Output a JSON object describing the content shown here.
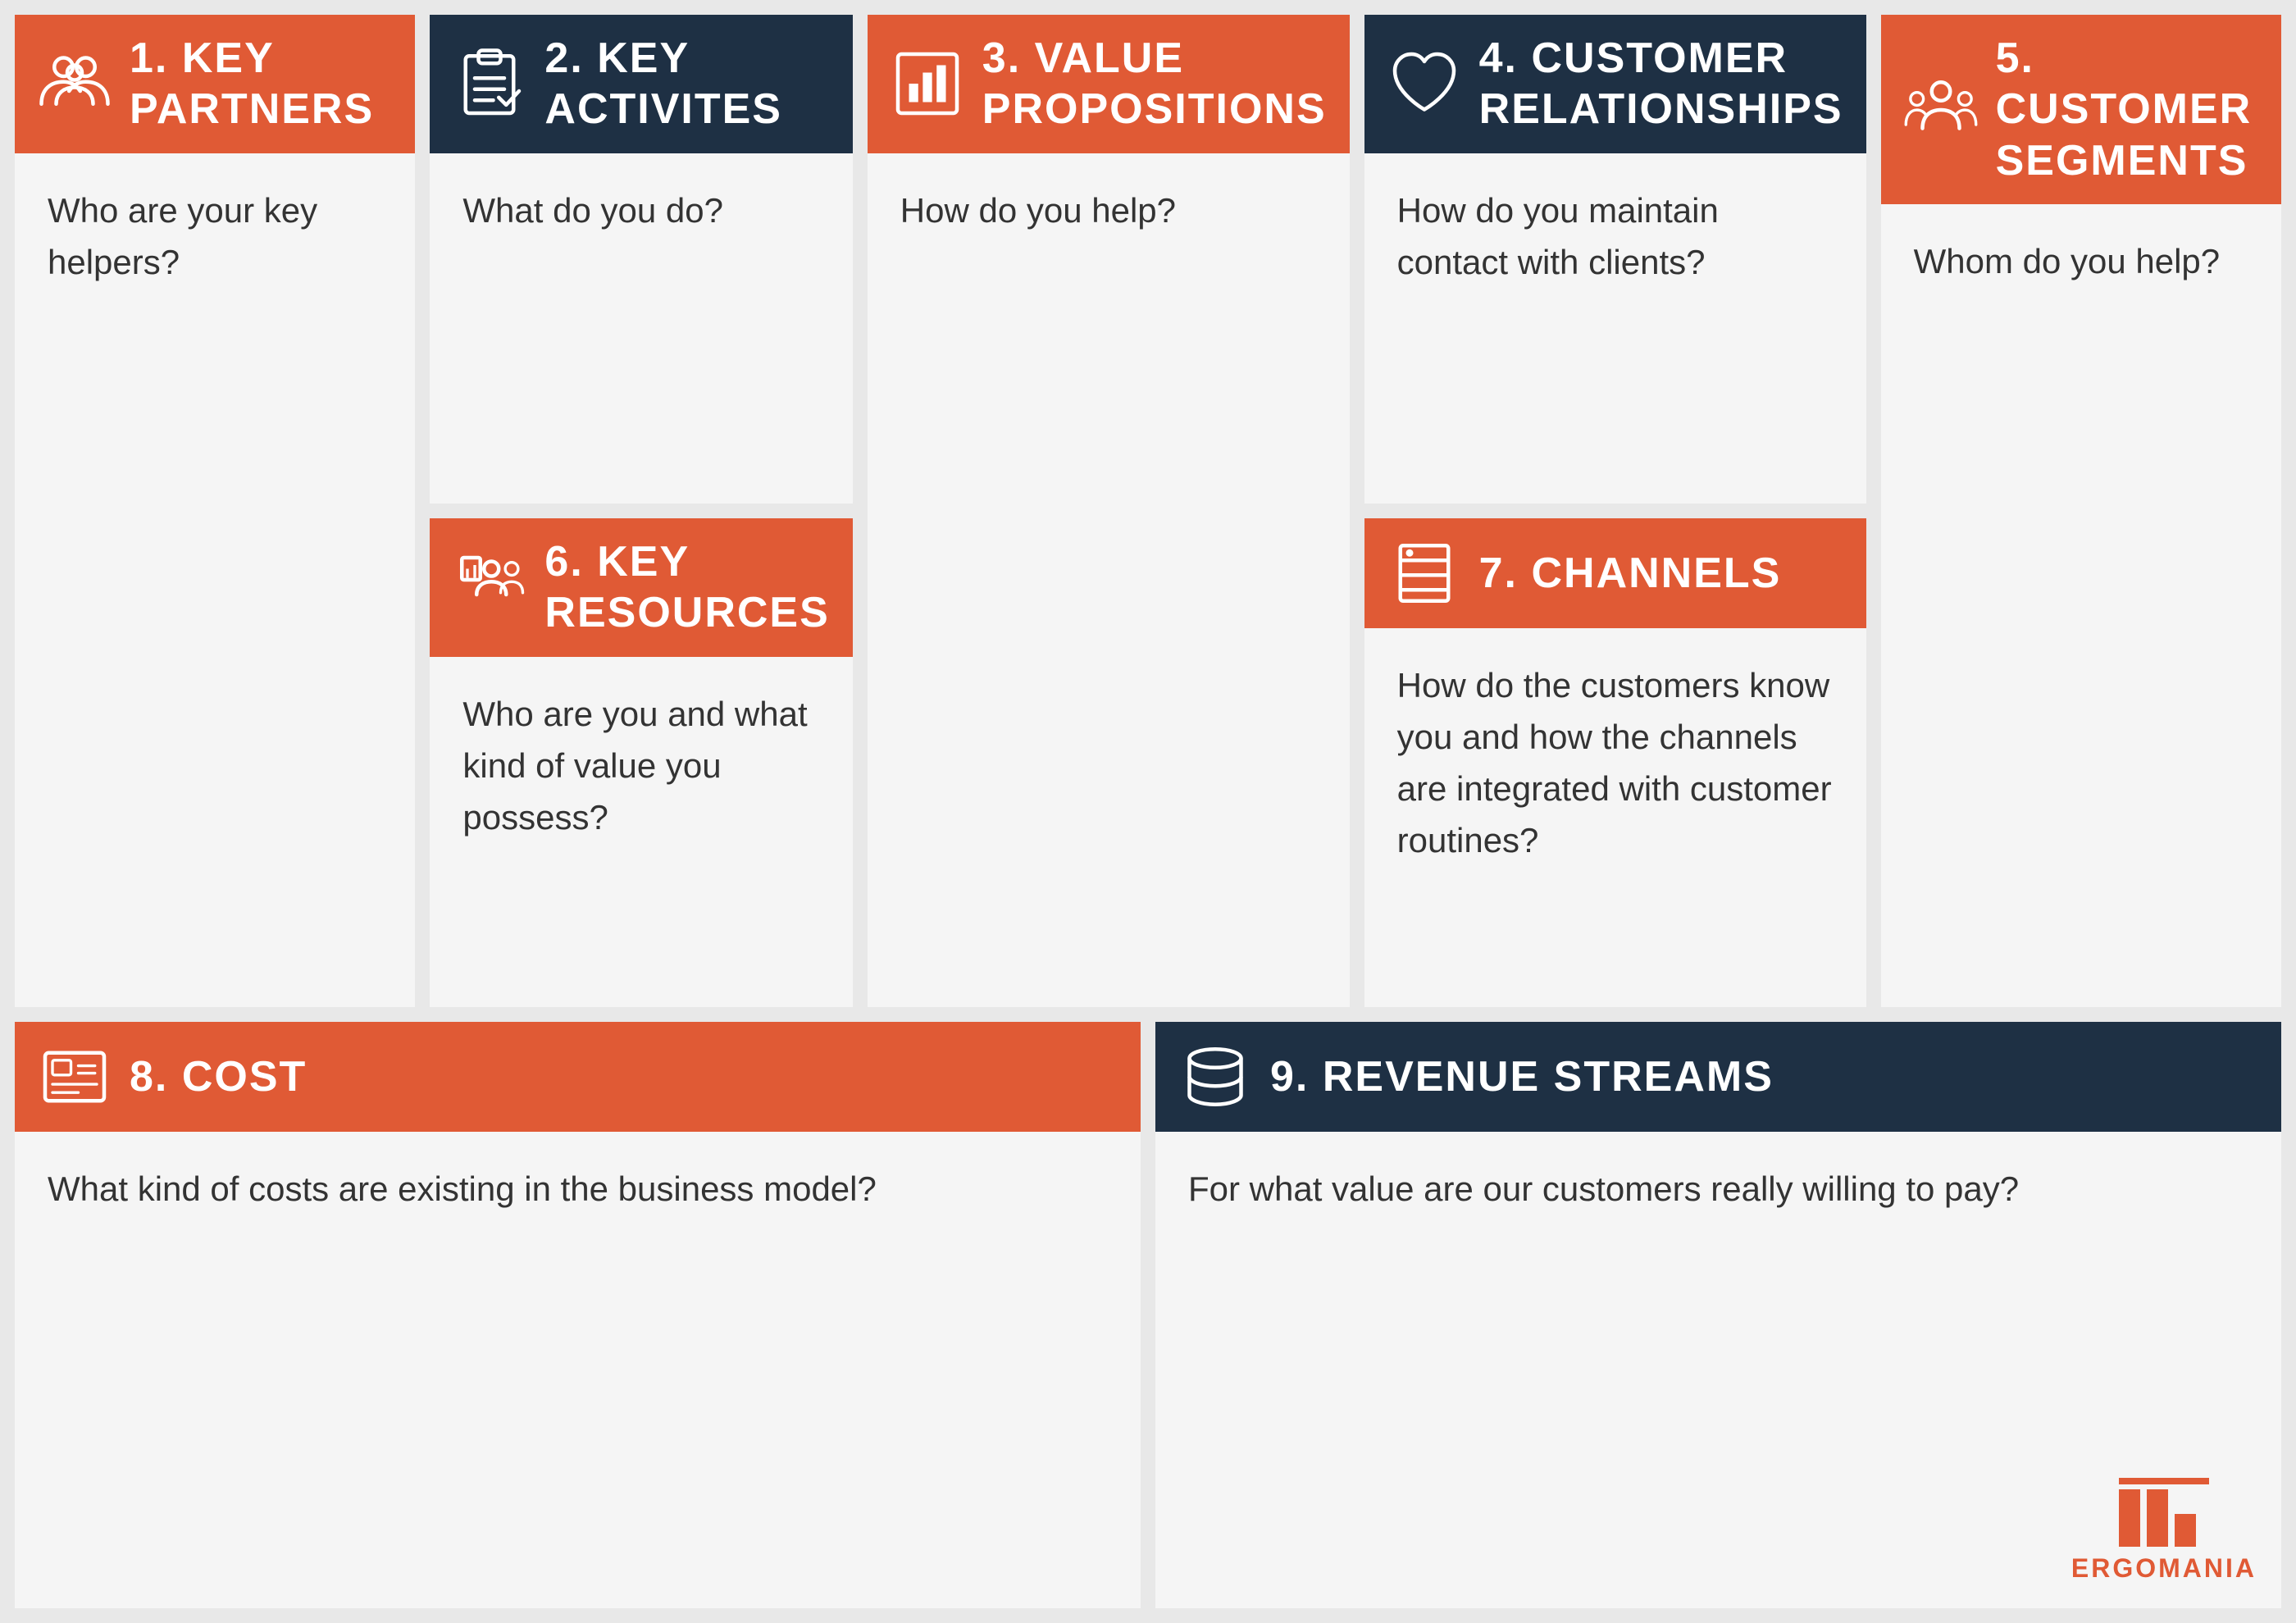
{
  "sections": {
    "keyPartners": {
      "number": "1.",
      "title": "KEY PARTNERS",
      "subtitle": "Who are your key helpers?",
      "headerStyle": "orange"
    },
    "keyActivities": {
      "number": "2.",
      "title": "KEY ACTIVITES",
      "subtitle": "What do you do?",
      "headerStyle": "dark"
    },
    "valuePropositions": {
      "number": "3.",
      "title": "VALUE PROPOSITIONS",
      "subtitle": "How do you help?",
      "headerStyle": "orange"
    },
    "customerRelationships": {
      "number": "4.",
      "title": "CUSTOMER RELATIONSHIPS",
      "subtitle": "How do you maintain contact with clients?",
      "headerStyle": "dark"
    },
    "customerSegments": {
      "number": "5.",
      "title": "CUSTOMER SEGMENTS",
      "subtitle": "Whom do you help?",
      "headerStyle": "orange"
    },
    "keyResources": {
      "number": "6.",
      "title": "KEY RESOURCES",
      "subtitle": "Who are you and what kind of value you possess?",
      "headerStyle": "orange"
    },
    "channels": {
      "number": "7.",
      "title": "CHANNELS",
      "subtitle": "How do the customers know you and how the channels are integrated with customer routines?",
      "headerStyle": "orange"
    },
    "cost": {
      "number": "8.",
      "title": "COST",
      "subtitle": "What kind of costs are existing in the business model?",
      "headerStyle": "orange"
    },
    "revenueStreams": {
      "number": "9.",
      "title": "REVENUE STREAMS",
      "subtitle": "For what value are our customers really willing to pay?",
      "headerStyle": "dark"
    }
  },
  "brand": {
    "name": "ERGOMANIA"
  }
}
